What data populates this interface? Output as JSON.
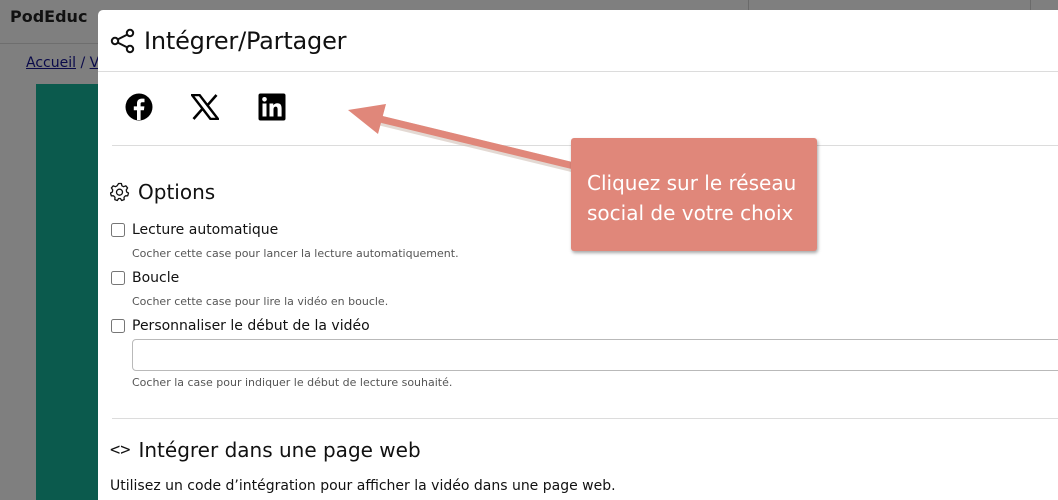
{
  "background": {
    "brand": "PodEduc",
    "breadcrumb": {
      "home": "Accueil",
      "separator": "/",
      "next_fragment": "V"
    }
  },
  "modal": {
    "title": "Intégrer/Partager",
    "title_icon": "share-icon",
    "social": [
      {
        "name": "facebook",
        "icon": "facebook-icon"
      },
      {
        "name": "x",
        "icon": "x-icon"
      },
      {
        "name": "linkedin",
        "icon": "linkedin-icon"
      }
    ],
    "options": {
      "heading": "Options",
      "icon": "gear-icon",
      "items": [
        {
          "label": "Lecture automatique",
          "help": "Cocher cette case pour lancer la lecture automatiquement.",
          "checked": false
        },
        {
          "label": "Boucle",
          "help": "Cocher cette case pour lire la vidéo en boucle.",
          "checked": false
        },
        {
          "label": "Personnaliser le début de la vidéo",
          "help": "Cocher la case pour indiquer le début de lecture souhaité.",
          "checked": false
        }
      ],
      "start_value": ""
    },
    "embed": {
      "heading": "Intégrer dans une page web",
      "icon": "code-icon",
      "description": "Utilisez un code d’intégration pour afficher la vidéo dans une page web."
    }
  },
  "annotation": {
    "line1": "Cliquez sur le réseau",
    "line2": "social de votre choix",
    "color": "#e0877a"
  },
  "colors": {
    "overlay": "#7f7f7f",
    "teal": "#0b5a4d"
  }
}
